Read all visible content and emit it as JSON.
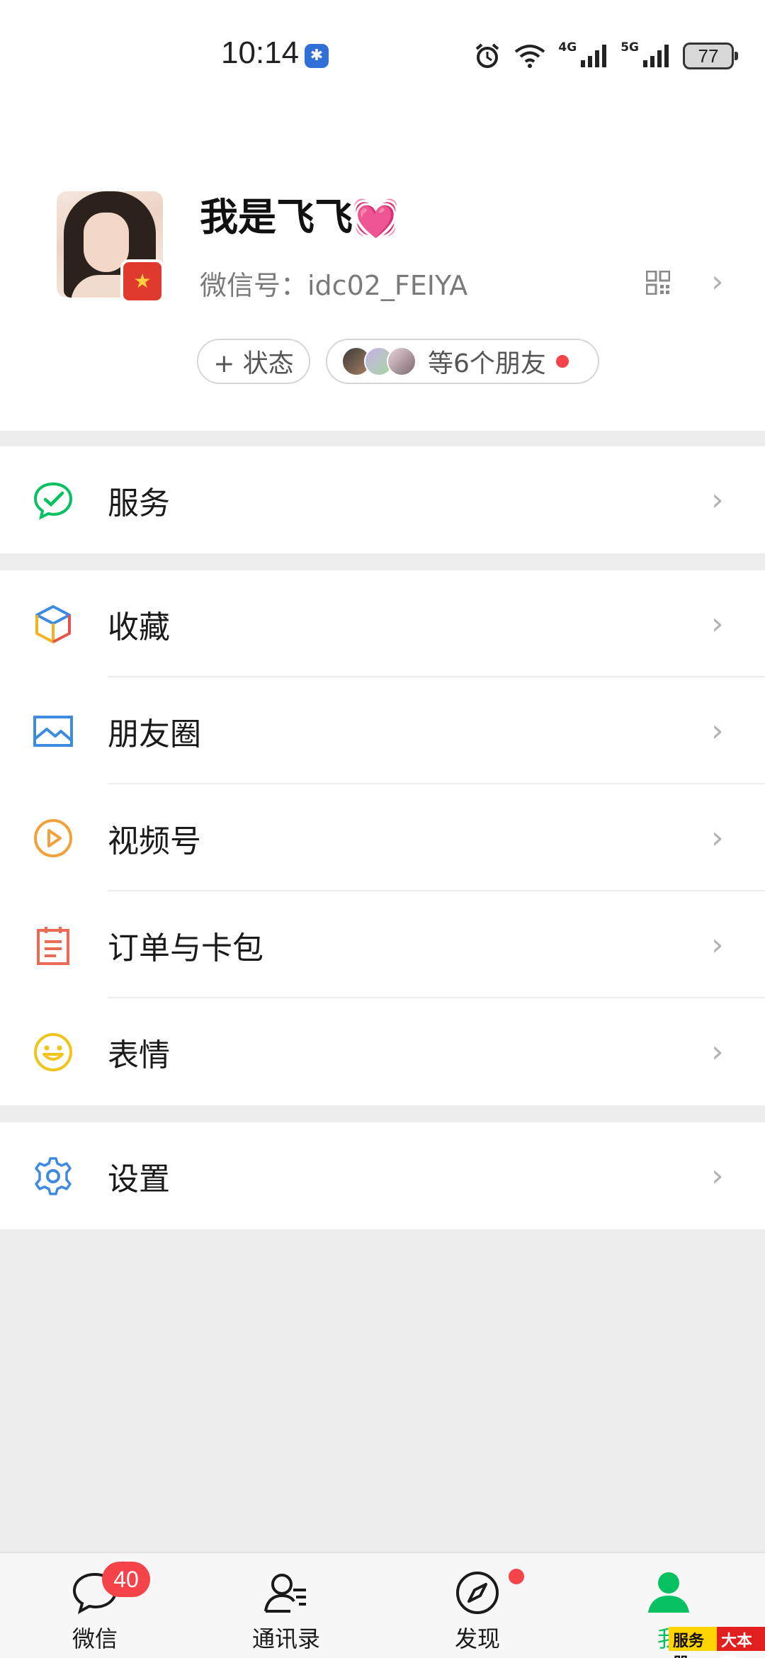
{
  "status_bar": {
    "time": "10:14",
    "net_4g": "4G",
    "net_5g": "5G",
    "battery": "77",
    "icons": [
      "app-notification-icon",
      "alarm-icon",
      "wifi-icon",
      "signal-icon"
    ]
  },
  "profile": {
    "nickname": "我是飞飞",
    "heart": "💓",
    "wechat_id": "微信号：idc02_FEIYA",
    "status_button": "+ 状态",
    "friends_text": "等6个朋友"
  },
  "menu_group1": [
    {
      "label": "服务",
      "icon": "service-check-icon"
    }
  ],
  "menu_group2": [
    {
      "label": "收藏",
      "icon": "favorites-cube-icon"
    },
    {
      "label": "朋友圈",
      "icon": "moments-image-icon"
    },
    {
      "label": "视频号",
      "icon": "channels-play-icon"
    },
    {
      "label": "订单与卡包",
      "icon": "orders-clipboard-icon"
    },
    {
      "label": "表情",
      "icon": "sticker-smile-icon"
    }
  ],
  "menu_group3": [
    {
      "label": "设置",
      "icon": "settings-gear-icon"
    }
  ],
  "tabbar": {
    "chats": "微信",
    "chats_badge": "40",
    "contacts": "通讯录",
    "discover": "发现",
    "me": "我"
  },
  "watermark": {
    "part1": "服务器",
    "part2": "大本营"
  },
  "colors": {
    "accent": "#07c160",
    "badge": "#f5434a",
    "background": "#ededed"
  }
}
